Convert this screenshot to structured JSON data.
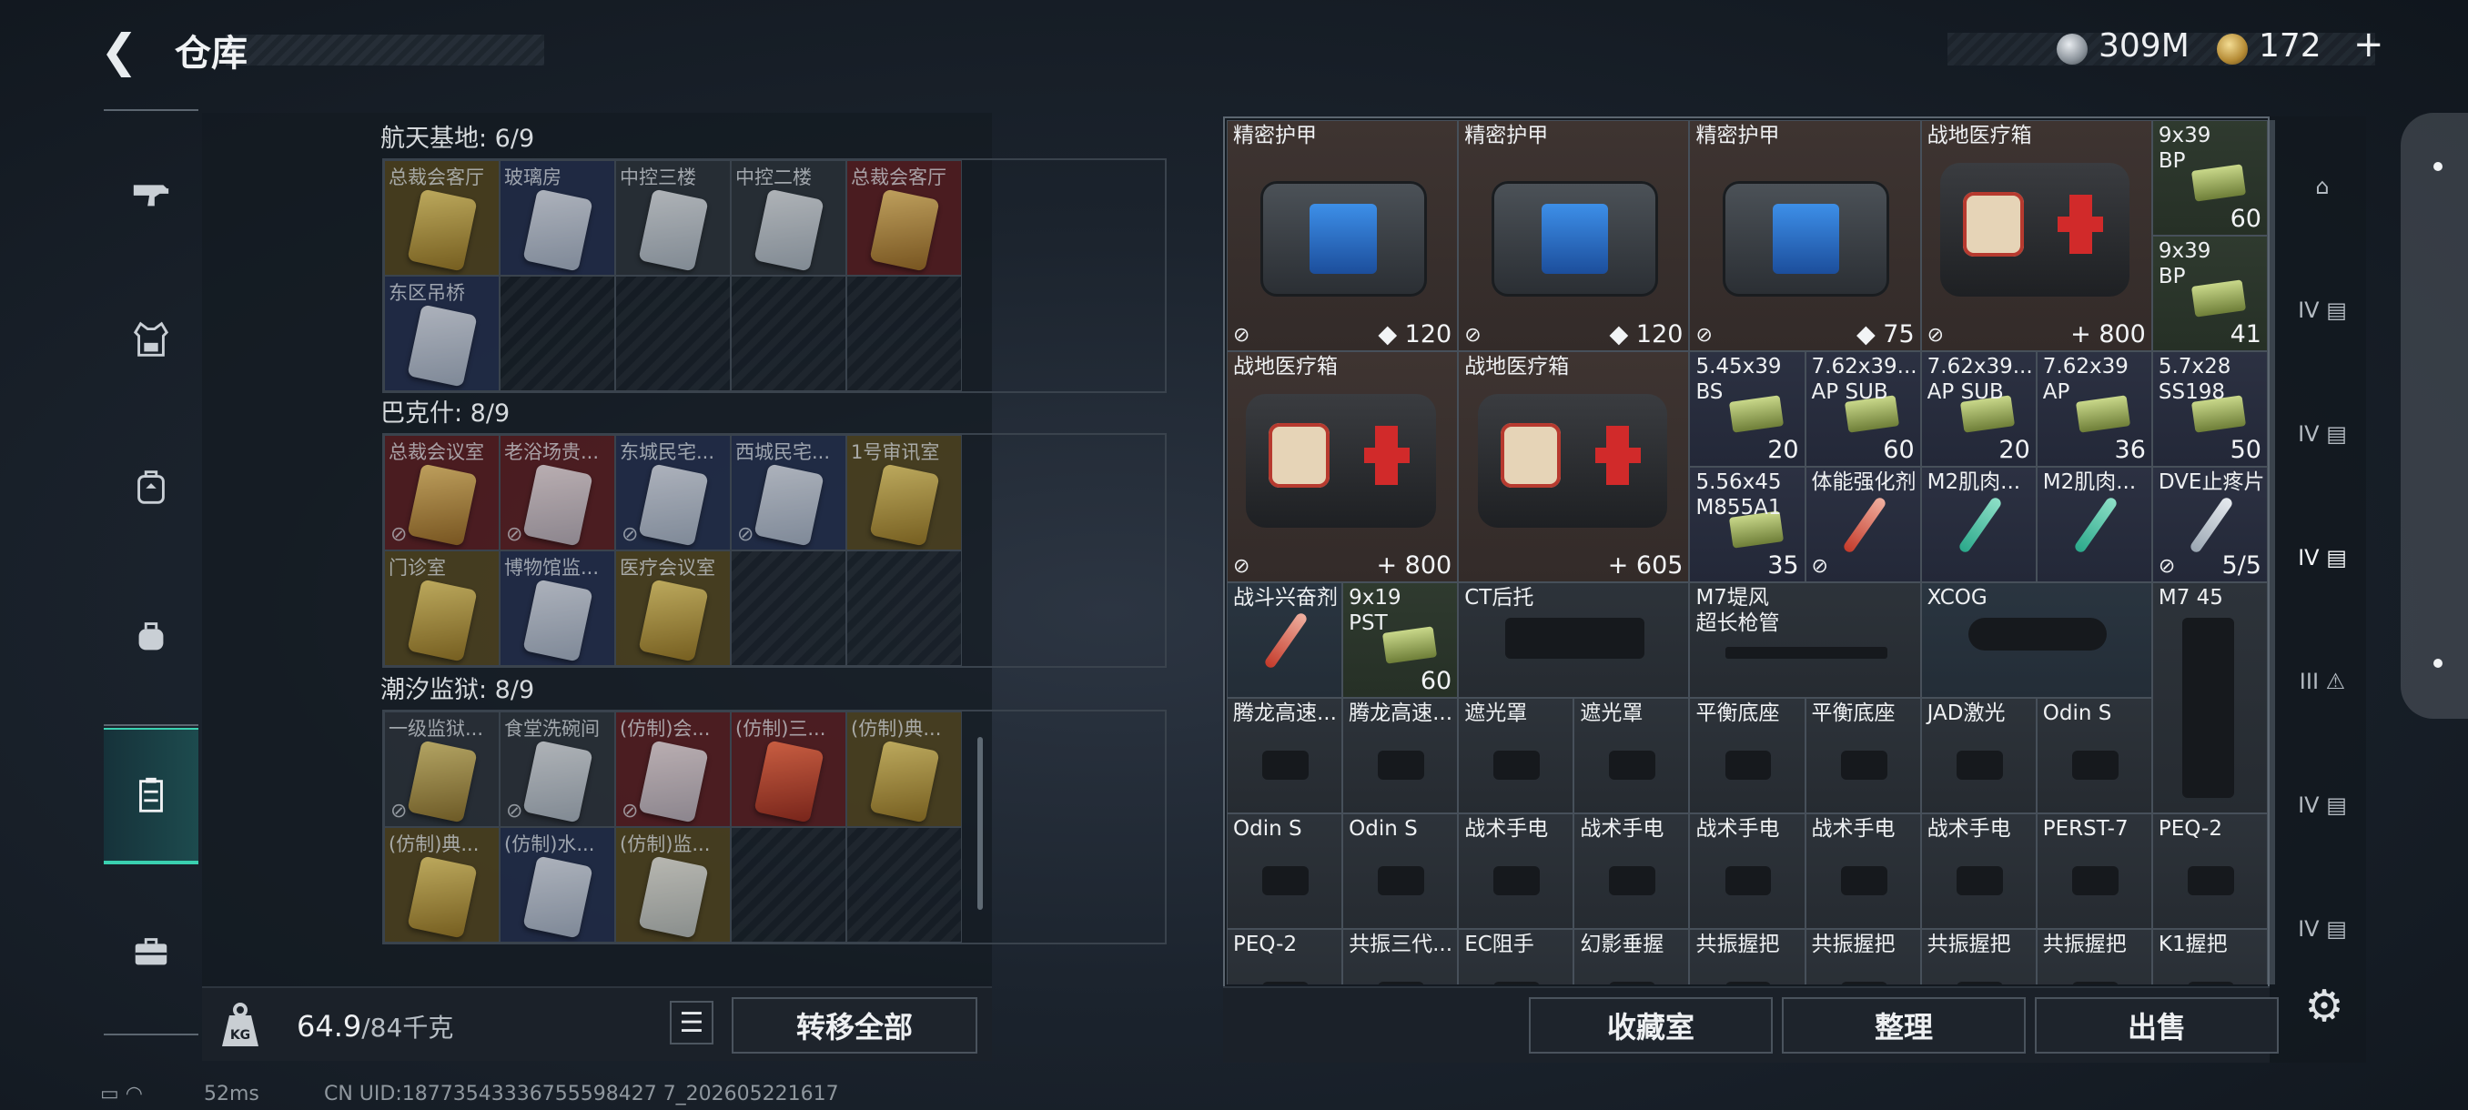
{
  "header": {
    "back_icon": "chevron-left-icon",
    "title": "仓库"
  },
  "currency": {
    "silver": "309M",
    "gold": "172",
    "add": "+"
  },
  "left_nav": [
    {
      "icon": "gun-icon"
    },
    {
      "icon": "armor-vest-icon"
    },
    {
      "icon": "backpack-icon"
    },
    {
      "icon": "bag-icon"
    },
    {
      "icon": "storage-box-icon",
      "active": true
    },
    {
      "icon": "toolbox-icon"
    }
  ],
  "keys": {
    "sections": [
      {
        "title": "航天基地: 6/9",
        "cards": [
          {
            "label": "总裁会客厅",
            "rarity": "gold",
            "color": "gold"
          },
          {
            "label": "玻璃房",
            "rarity": "blue",
            "color": "white"
          },
          {
            "label": "中控三楼",
            "rarity": "gray",
            "color": "white"
          },
          {
            "label": "中控二楼",
            "rarity": "gray",
            "color": "white"
          },
          {
            "label": "总裁会客厅",
            "rarity": "red",
            "color": "gold"
          },
          {
            "label": "东区吊桥",
            "rarity": "blue",
            "color": "white"
          },
          {
            "label": "",
            "rarity": "empty"
          },
          {
            "label": "",
            "rarity": "empty"
          },
          {
            "label": "",
            "rarity": "empty"
          },
          {
            "label": "",
            "rarity": "empty"
          }
        ]
      },
      {
        "title": "巴克什: 8/9",
        "cards": [
          {
            "label": "总裁会议室",
            "rarity": "red",
            "color": "gold",
            "bound": true
          },
          {
            "label": "老浴场贵...",
            "rarity": "red",
            "color": "white",
            "bound": true
          },
          {
            "label": "东城民宅...",
            "rarity": "blue",
            "color": "white",
            "bound": true
          },
          {
            "label": "西城民宅...",
            "rarity": "blue",
            "color": "white",
            "bound": true
          },
          {
            "label": "1号审讯室",
            "rarity": "gold",
            "color": "gold"
          },
          {
            "label": "门诊室",
            "rarity": "gold",
            "color": "gold"
          },
          {
            "label": "博物馆监...",
            "rarity": "blue",
            "color": "white"
          },
          {
            "label": "医疗会议室",
            "rarity": "gold",
            "color": "gold"
          },
          {
            "label": "",
            "rarity": "empty"
          },
          {
            "label": "",
            "rarity": "empty"
          }
        ]
      },
      {
        "title": "潮汐监狱: 8/9",
        "cards": [
          {
            "label": "一级监狱...",
            "rarity": "gray",
            "color": "gold",
            "bound": true
          },
          {
            "label": "食堂洗碗间",
            "rarity": "gray",
            "color": "white",
            "bound": true
          },
          {
            "label": "(仿制)会...",
            "rarity": "red",
            "color": "white",
            "bound": true
          },
          {
            "label": "(仿制)三...",
            "rarity": "red",
            "color": "red"
          },
          {
            "label": "(仿制)典...",
            "rarity": "gold",
            "color": "gold"
          },
          {
            "label": "(仿制)典...",
            "rarity": "gold",
            "color": "gold"
          },
          {
            "label": "(仿制)水...",
            "rarity": "blue",
            "color": "white"
          },
          {
            "label": "(仿制)监...",
            "rarity": "gold",
            "color": "white"
          },
          {
            "label": "",
            "rarity": "empty"
          },
          {
            "label": "",
            "rarity": "empty"
          }
        ]
      }
    ]
  },
  "bottom_left": {
    "weight_current": "64.9",
    "weight_max": "/84千克",
    "transfer_all": "转移全部",
    "list_icon": "list-icon",
    "weight_icon": "weight-icon"
  },
  "status": {
    "ping": "52ms",
    "uid": "CN UID:18773543336755598427 7_202605221617"
  },
  "items": [
    {
      "name": "精密护甲",
      "qty": "120",
      "qicon": "◆",
      "bg": "brown",
      "kind": "bag",
      "lock": "⊘"
    },
    {
      "name": "精密护甲",
      "qty": "120",
      "qicon": "◆",
      "bg": "brown",
      "kind": "bag",
      "lock": "⊘"
    },
    {
      "name": "精密护甲",
      "qty": "75",
      "qicon": "◆",
      "bg": "brown",
      "kind": "bag",
      "lock": "⊘"
    },
    {
      "name": "战地医疗箱",
      "qty": "800",
      "qicon": "+",
      "bg": "brown",
      "kind": "med",
      "lock": "⊘"
    },
    {
      "name": "9x39\nBP",
      "qty": "60",
      "bg": "green",
      "kind": "ammo"
    },
    {
      "name": "9x39\nBP",
      "qty": "41",
      "bg": "green",
      "kind": "ammo"
    },
    {
      "name": "战地医疗箱",
      "qty": "800",
      "qicon": "+",
      "bg": "brown",
      "kind": "med",
      "lock": "⊘"
    },
    {
      "name": "战地医疗箱",
      "qty": "605",
      "qicon": "+",
      "bg": "brown",
      "kind": "med"
    },
    {
      "name": "5.45x39\nBS",
      "qty": "20",
      "bg": "blue",
      "kind": "ammo"
    },
    {
      "name": "7.62x39...\nAP SUB",
      "qty": "60",
      "bg": "blue",
      "kind": "ammo"
    },
    {
      "name": "7.62x39...\nAP SUB",
      "qty": "20",
      "bg": "blue",
      "kind": "ammo"
    },
    {
      "name": "7.62x39\nAP",
      "qty": "36",
      "bg": "blue",
      "kind": "ammo"
    },
    {
      "name": "5.7x28\nSS198",
      "qty": "50",
      "bg": "blue",
      "kind": "ammo"
    },
    {
      "name": "5.56x45\nM855A1",
      "qty": "35",
      "bg": "blue",
      "kind": "ammo"
    },
    {
      "name": "体能强化剂",
      "bg": "blue",
      "kind": "inj",
      "lock": "⊘"
    },
    {
      "name": "M2肌肉...",
      "bg": "blue",
      "kind": "inj"
    },
    {
      "name": "M2肌肉...",
      "bg": "blue",
      "kind": "inj"
    },
    {
      "name": "DVE止疼片",
      "qty": "5/5",
      "bg": "blue",
      "kind": "inj",
      "lock": "⊘"
    },
    {
      "name": "战斗兴奋剂",
      "bg": "slate",
      "kind": "inj"
    },
    {
      "name": "9x19\nPST",
      "qty": "60",
      "bg": "green",
      "kind": "ammo"
    },
    {
      "name": "CT后托",
      "bg": "gray",
      "kind": "stock"
    },
    {
      "name": "M7堤风\n超长枪管",
      "bg": "gray",
      "kind": "barrel"
    },
    {
      "name": "XCOG",
      "bg": "slate",
      "kind": "scope"
    },
    {
      "name": "M7 45",
      "bg": "gray",
      "kind": "mag"
    },
    {
      "name": "腾龙高速...",
      "bg": "gray",
      "kind": "part"
    },
    {
      "name": "腾龙高速...",
      "bg": "gray",
      "kind": "part"
    },
    {
      "name": "遮光罩",
      "bg": "gray",
      "kind": "part"
    },
    {
      "name": "遮光罩",
      "bg": "gray",
      "kind": "part"
    },
    {
      "name": "平衡底座",
      "bg": "gray",
      "kind": "part"
    },
    {
      "name": "平衡底座",
      "bg": "gray",
      "kind": "part"
    },
    {
      "name": "JAD激光",
      "bg": "gray",
      "kind": "part"
    },
    {
      "name": "Odin S",
      "bg": "gray",
      "kind": "part"
    },
    {
      "name": "Odin S",
      "bg": "gray",
      "kind": "part"
    },
    {
      "name": "Odin S",
      "bg": "gray",
      "kind": "part"
    },
    {
      "name": "战术手电",
      "bg": "gray",
      "kind": "part"
    },
    {
      "name": "战术手电",
      "bg": "gray",
      "kind": "part"
    },
    {
      "name": "战术手电",
      "bg": "gray",
      "kind": "part"
    },
    {
      "name": "战术手电",
      "bg": "gray",
      "kind": "part"
    },
    {
      "name": "战术手电",
      "bg": "gray",
      "kind": "part"
    },
    {
      "name": "PERST-7",
      "bg": "gray",
      "kind": "part"
    },
    {
      "name": "PEQ-2",
      "bg": "gray",
      "kind": "part"
    },
    {
      "name": "PEQ-2",
      "bg": "gray",
      "kind": "part"
    },
    {
      "name": "共振三代...",
      "bg": "gray",
      "kind": "part"
    },
    {
      "name": "EC阻手",
      "bg": "gray",
      "kind": "part"
    },
    {
      "name": "幻影垂握",
      "bg": "gray",
      "kind": "part"
    },
    {
      "name": "共振握把",
      "bg": "gray",
      "kind": "part"
    },
    {
      "name": "共振握把",
      "bg": "gray",
      "kind": "part"
    },
    {
      "name": "共振握把",
      "bg": "gray",
      "kind": "part"
    },
    {
      "name": "共振握把",
      "bg": "gray",
      "kind": "part"
    },
    {
      "name": "K1握把",
      "bg": "gray",
      "kind": "part"
    }
  ],
  "bottom_right": {
    "collection": "收藏室",
    "sort": "整理",
    "sell": "出售"
  },
  "right_nav": [
    {
      "label": "",
      "icon": "arch-icon"
    },
    {
      "label": "IV",
      "icon": "safe-box-icon"
    },
    {
      "label": "IV",
      "icon": "safe-box-icon"
    },
    {
      "label": "IV",
      "icon": "safe-box-icon",
      "active": true
    },
    {
      "label": "III",
      "icon": "warning-box-icon"
    },
    {
      "label": "IV",
      "icon": "safe-box-icon"
    },
    {
      "label": "IV",
      "icon": "safe-box-icon"
    }
  ],
  "settings_icon": "gear-icon"
}
